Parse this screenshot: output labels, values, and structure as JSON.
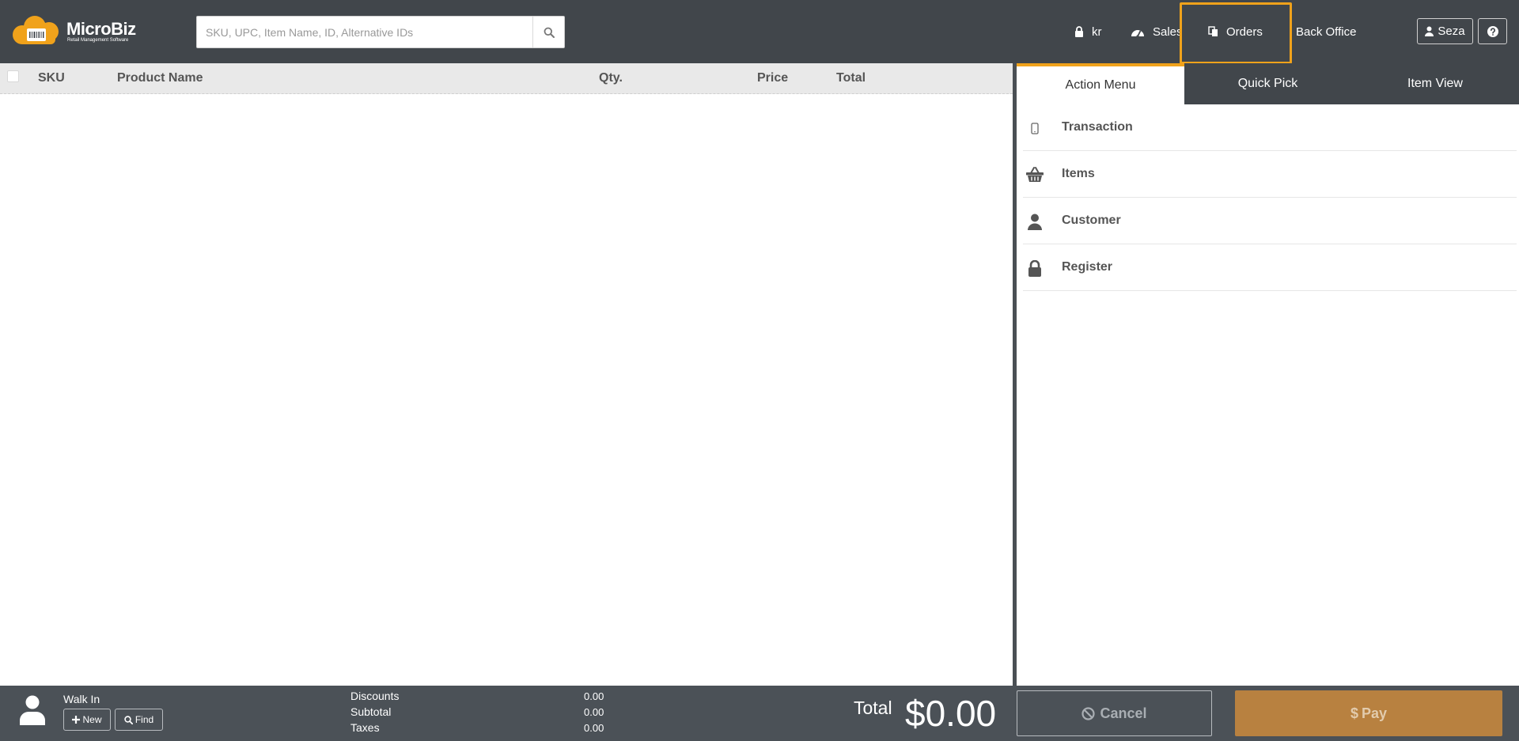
{
  "app": {
    "logo_name": "MicroBiz",
    "logo_tagline": "Retail Management Software"
  },
  "search": {
    "placeholder": "SKU, UPC, Item Name, ID, Alternative IDs",
    "value": ""
  },
  "nav": {
    "lock_label": "kr",
    "sales_label": "Sales",
    "orders_label": "Orders",
    "backoffice_label": "Back Office",
    "user_label": "Seza"
  },
  "table": {
    "headers": [
      "SKU",
      "Product Name",
      "Qty.",
      "Price",
      "Total"
    ],
    "rows": []
  },
  "right_panel": {
    "tabs": [
      {
        "label": "Action Menu",
        "active": true
      },
      {
        "label": "Quick Pick",
        "active": false
      },
      {
        "label": "Item View",
        "active": false
      }
    ],
    "menu": [
      {
        "label": "Transaction",
        "icon": "mobile-icon"
      },
      {
        "label": "Items",
        "icon": "basket-icon"
      },
      {
        "label": "Customer",
        "icon": "user-icon"
      },
      {
        "label": "Register",
        "icon": "lock-icon"
      }
    ]
  },
  "footer": {
    "customer_name": "Walk In",
    "new_label": "New",
    "find_label": "Find",
    "discounts_label": "Discounts",
    "discounts_value": "0.00",
    "subtotal_label": "Subtotal",
    "subtotal_value": "0.00",
    "taxes_label": "Taxes",
    "taxes_value": "0.00",
    "total_label": "Total",
    "total_value": "$0.00",
    "cancel_label": "Cancel",
    "pay_label": "Pay"
  },
  "colors": {
    "topbar": "#41464b",
    "accent": "#f0a21b",
    "pay_button": "#b88140",
    "bottombar": "#4b5157"
  }
}
